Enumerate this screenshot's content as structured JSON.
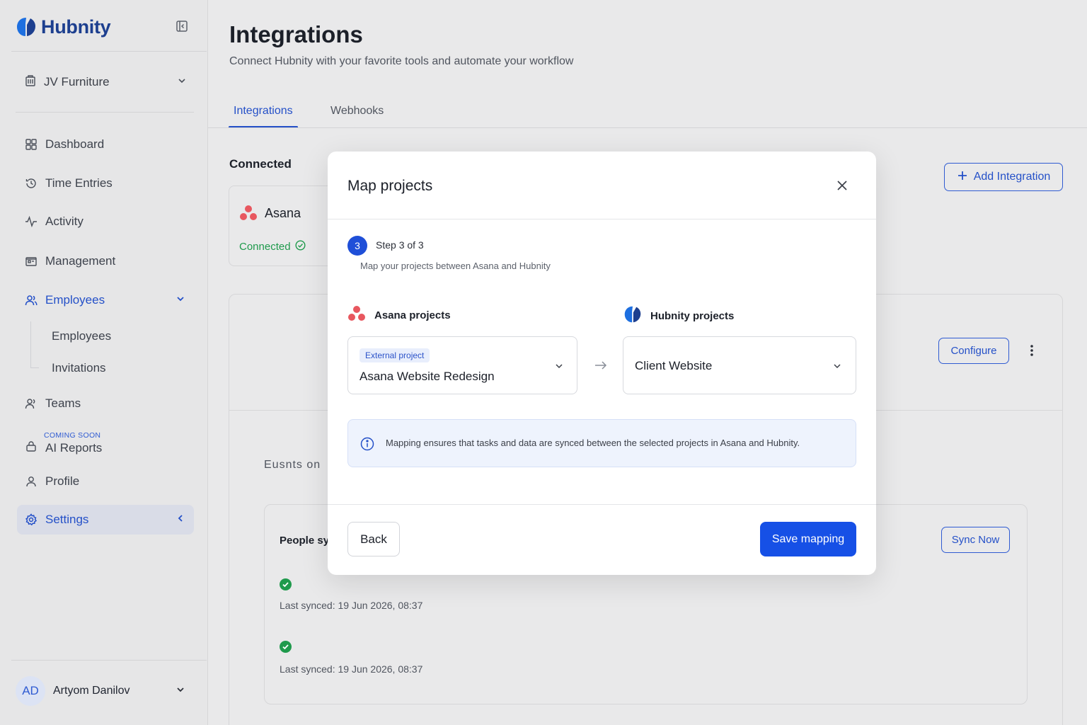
{
  "app": {
    "brand": "Hubnity",
    "brand_color": "#1d3f8f",
    "accent_color": "#2450c8"
  },
  "sidebar": {
    "org": {
      "label": "JV Furniture",
      "icon": "building-icon"
    },
    "items": [
      {
        "label": "Dashboard",
        "icon": "grid-icon"
      },
      {
        "label": "Time Entries",
        "icon": "history-clock-icon"
      },
      {
        "label": "Activity",
        "icon": "activity-pulse-icon"
      },
      {
        "label": "Management",
        "icon": "folder-icon"
      },
      {
        "label": "Employees",
        "icon": "users-icon",
        "expanded": true
      },
      {
        "label": "Teams",
        "icon": "team-icon"
      },
      {
        "label": "AI Reports",
        "icon": "lock-icon",
        "badge": "COMING SOON"
      },
      {
        "label": "Profile",
        "icon": "user-icon"
      },
      {
        "label": "Settings",
        "icon": "gear-icon",
        "selected": true
      }
    ],
    "employees_sub": [
      "Employees",
      "Invitations"
    ],
    "user": {
      "initials": "AD",
      "name": "Artyom Danilov"
    }
  },
  "page": {
    "title": "Integrations",
    "subtitle": "Connect Hubnity with your favorite tools and automate your workflow",
    "tabs": [
      {
        "label": "Integrations",
        "active": true
      },
      {
        "label": "Webhooks",
        "active": false
      }
    ],
    "section_connected": "Connected",
    "add_integration": "Add Integration",
    "asana_card": {
      "name": "Asana",
      "status": "Connected"
    },
    "configure": "Configure",
    "events_label": "Eusnts  on",
    "people_sync": "People syr",
    "sync_now": "Sync Now",
    "sync_rows": [
      {
        "text": "Last synced:  19 Jun 2026, 08:37"
      },
      {
        "text": "Last synced: 19 Jun 2026, 08:37"
      }
    ]
  },
  "modal": {
    "title": "Map projects",
    "step_number": "3",
    "step_text": "Step 3 of 3",
    "step_description": "Map your projects between Asana and Hubnity",
    "left_column": {
      "title": "Asana projects",
      "tag": "External project",
      "value": "Asana Website Redesign"
    },
    "right_column": {
      "title": "Hubnity projects",
      "value": "Client Website"
    },
    "info": "Mapping ensures that tasks and data are synced between the selected projects in Asana and Hubnity.",
    "back": "Back",
    "save": "Save mapping"
  }
}
